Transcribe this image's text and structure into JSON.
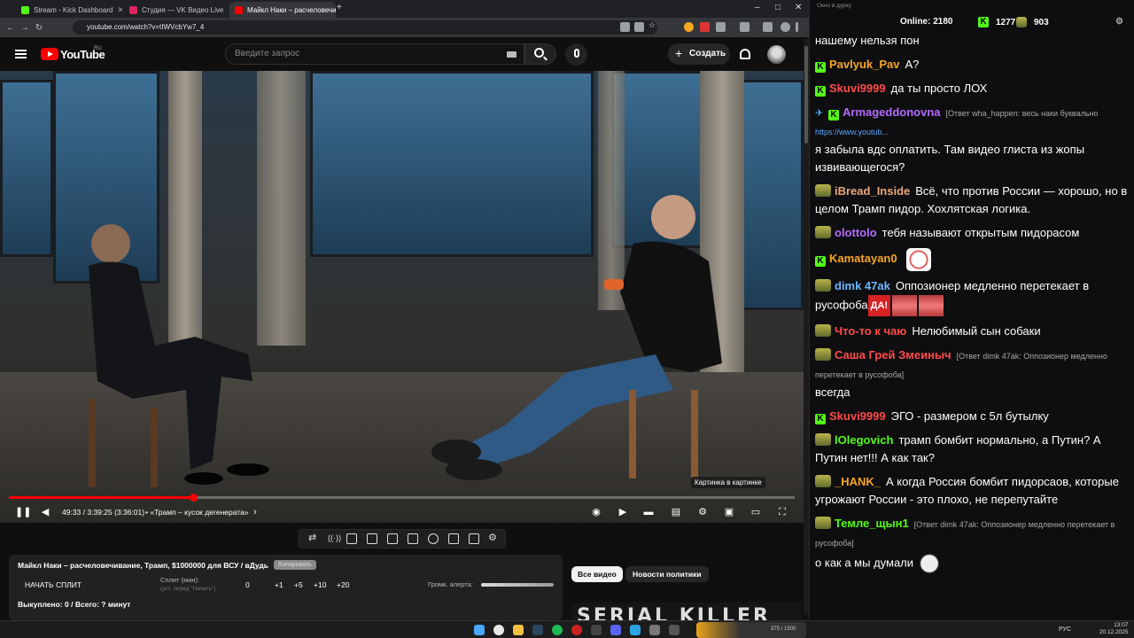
{
  "tabs": [
    {
      "label": "Stream - Kick Dashboard",
      "color": "#53fc18"
    },
    {
      "label": "Студия — VK Видео Live",
      "color": "#e0245e"
    },
    {
      "label": "Майкл Наки – расчеловечи...",
      "color": "#ff0000"
    }
  ],
  "address": {
    "url": "youtube.com/watch?v=tIWVcbYw7_4"
  },
  "youtube": {
    "logo": "YouTube",
    "country": "RU",
    "search_placeholder": "Введите запрос",
    "create_label": "Создать"
  },
  "player": {
    "progress": 0.235,
    "time": "49:33 / 3:39:25  (3:36:01)",
    "chapter": "• «Трамп – кусок дегенерата»",
    "tooltip": "Картинка в картинке"
  },
  "panel": {
    "title": "Майкл Наки – расчеловечивание, Трамп, $1000000 для ВСУ / вДудь",
    "copy_label": "Копировать",
    "split_button": "НАЧАТЬ СПЛИТ",
    "split_label": "Сплит (мин):",
    "split_hint": "(уст. перед \"Начать\")",
    "split_value": "0",
    "steps": [
      "+1",
      "+5",
      "+10",
      "+20"
    ],
    "alert_label": "Громк. алерта:",
    "sold": "Выкуплено: 0 / Всего: ? минут"
  },
  "chips": {
    "all": "Все видео",
    "news": "Новости политики"
  },
  "thumbnail": {
    "text": "SERIAL KILLER"
  },
  "chat": {
    "window_title": "Окно в дурку",
    "online_label": "Online:",
    "online": "2180",
    "kick_viewers": "1277",
    "vk_viewers": "903",
    "messages": [
      {
        "badge": "none",
        "nick": "",
        "color": "#fff",
        "reply": "",
        "text": "нашему нельзя пон",
        "emote": ""
      },
      {
        "badge": "kick",
        "nick": "Pavlyuk_Pav",
        "color": "#f5a623",
        "reply": "",
        "text": "А?",
        "emote": ""
      },
      {
        "badge": "kick",
        "nick": "Skuvi9999",
        "color": "#ff4b4b",
        "reply": "",
        "text": "да ты просто ЛОХ",
        "emote": ""
      },
      {
        "badge": "tg-kick",
        "nick": "Armageddonovna",
        "color": "#b46bff",
        "reply": "[Ответ wha_happen: весь наки буквально ",
        "link": "https://www.youtub...",
        "text": "я забыла вдс оплатить. Там видео глиста из жопы извивающегося?",
        "emote": ""
      },
      {
        "badge": "vk",
        "nick": "iBread_Inside",
        "color": "#e8a87c",
        "reply": "",
        "text": "Всё, что против России — хорошо, но в целом Трамп пидор. Хохлятская логика.",
        "emote": ""
      },
      {
        "badge": "vk",
        "nick": "olottolo",
        "color": "#b46bff",
        "reply": "",
        "text": "тебя называют открытым пидорасом",
        "emote": ""
      },
      {
        "badge": "kick",
        "nick": "Kamatayan0",
        "color": "#f5a623",
        "reply": "",
        "text": "",
        "emote": "face"
      },
      {
        "badge": "vk",
        "nick": "dimk 47ak",
        "color": "#6bb6ff",
        "reply": "",
        "text": "Оппозионер медленно перетекает в русофоба",
        "emote": "da"
      },
      {
        "badge": "vk",
        "nick": "Что-то к чаю",
        "color": "#ff4b4b",
        "reply": "",
        "text": "Нелюбимый сын собаки",
        "emote": ""
      },
      {
        "badge": "vk",
        "nick": "Саша Грей Змеиныч",
        "color": "#ff4b4b",
        "reply": "[Ответ dimk 47ak: Оппозионер медленно перетекает в русофоба]",
        "text": "всегда",
        "emote": ""
      },
      {
        "badge": "kick",
        "nick": "Skuvi9999",
        "color": "#ff4b4b",
        "reply": "",
        "text": "ЭГО - размером с 5л бутылку",
        "emote": ""
      },
      {
        "badge": "vk",
        "nick": "lOlegovich",
        "color": "#53fc18",
        "reply": "",
        "text": "трамп бомбит нормально, а Путин? А Путин нет!!! А как так?",
        "emote": ""
      },
      {
        "badge": "vk",
        "nick": "_HANK_",
        "color": "#f5a623",
        "reply": "",
        "text": "А когда Россия бомбит пидорсаов, которые угрожают России - это плохо, не перепутайте",
        "emote": ""
      },
      {
        "badge": "vk",
        "nick": "Темле_щын1",
        "color": "#53fc18",
        "reply": "[Ответ dimk 47ak: Оппозионер медленно перетекает в русофоба]",
        "text": "о как а мы думали",
        "emote": "face2"
      }
    ]
  },
  "taskbar": {
    "game_score": "375 / 1500",
    "lang": "РУС",
    "time": "13:07",
    "date": "20.12.2025"
  }
}
